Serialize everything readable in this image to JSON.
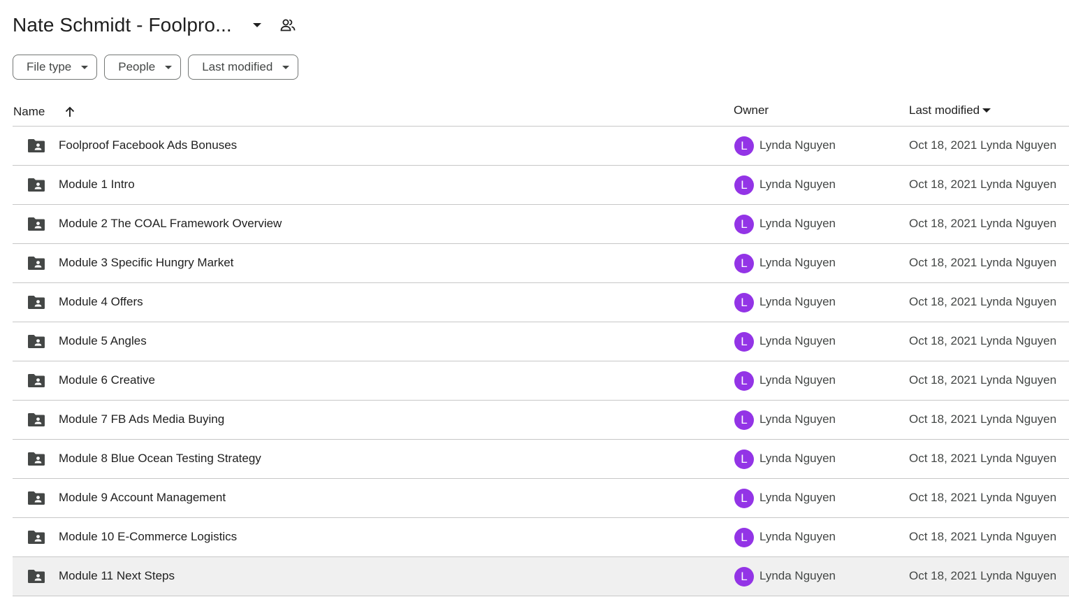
{
  "header": {
    "title": "Nate Schmidt - Foolpro..."
  },
  "filters": [
    {
      "label": "File type"
    },
    {
      "label": "People"
    },
    {
      "label": "Last modified"
    }
  ],
  "columns": {
    "name": "Name",
    "owner": "Owner",
    "last_modified": "Last modified"
  },
  "colors": {
    "avatar": "#9334e6",
    "folder": "#444746",
    "selected_row": "#f0f0f0"
  },
  "rows": [
    {
      "name": "Foolproof Facebook Ads Bonuses",
      "avatar": "L",
      "owner": "Lynda Nguyen",
      "modified": "Oct 18, 2021 Lynda Nguyen"
    },
    {
      "name": "Module 1 Intro",
      "avatar": "L",
      "owner": "Lynda Nguyen",
      "modified": "Oct 18, 2021 Lynda Nguyen"
    },
    {
      "name": "Module 2 The COAL Framework Overview",
      "avatar": "L",
      "owner": "Lynda Nguyen",
      "modified": "Oct 18, 2021 Lynda Nguyen"
    },
    {
      "name": "Module 3 Specific Hungry Market",
      "avatar": "L",
      "owner": "Lynda Nguyen",
      "modified": "Oct 18, 2021 Lynda Nguyen"
    },
    {
      "name": "Module 4 Offers",
      "avatar": "L",
      "owner": "Lynda Nguyen",
      "modified": "Oct 18, 2021 Lynda Nguyen"
    },
    {
      "name": "Module 5 Angles",
      "avatar": "L",
      "owner": "Lynda Nguyen",
      "modified": "Oct 18, 2021 Lynda Nguyen"
    },
    {
      "name": "Module 6 Creative",
      "avatar": "L",
      "owner": "Lynda Nguyen",
      "modified": "Oct 18, 2021 Lynda Nguyen"
    },
    {
      "name": "Module 7 FB Ads Media Buying",
      "avatar": "L",
      "owner": "Lynda Nguyen",
      "modified": "Oct 18, 2021 Lynda Nguyen"
    },
    {
      "name": "Module 8 Blue Ocean Testing Strategy",
      "avatar": "L",
      "owner": "Lynda Nguyen",
      "modified": "Oct 18, 2021 Lynda Nguyen"
    },
    {
      "name": "Module 9 Account Management",
      "avatar": "L",
      "owner": "Lynda Nguyen",
      "modified": "Oct 18, 2021 Lynda Nguyen"
    },
    {
      "name": "Module 10 E-Commerce Logistics",
      "avatar": "L",
      "owner": "Lynda Nguyen",
      "modified": "Oct 18, 2021 Lynda Nguyen"
    },
    {
      "name": "Module 11 Next Steps",
      "avatar": "L",
      "owner": "Lynda Nguyen",
      "modified": "Oct 18, 2021 Lynda Nguyen",
      "selected": true
    }
  ]
}
